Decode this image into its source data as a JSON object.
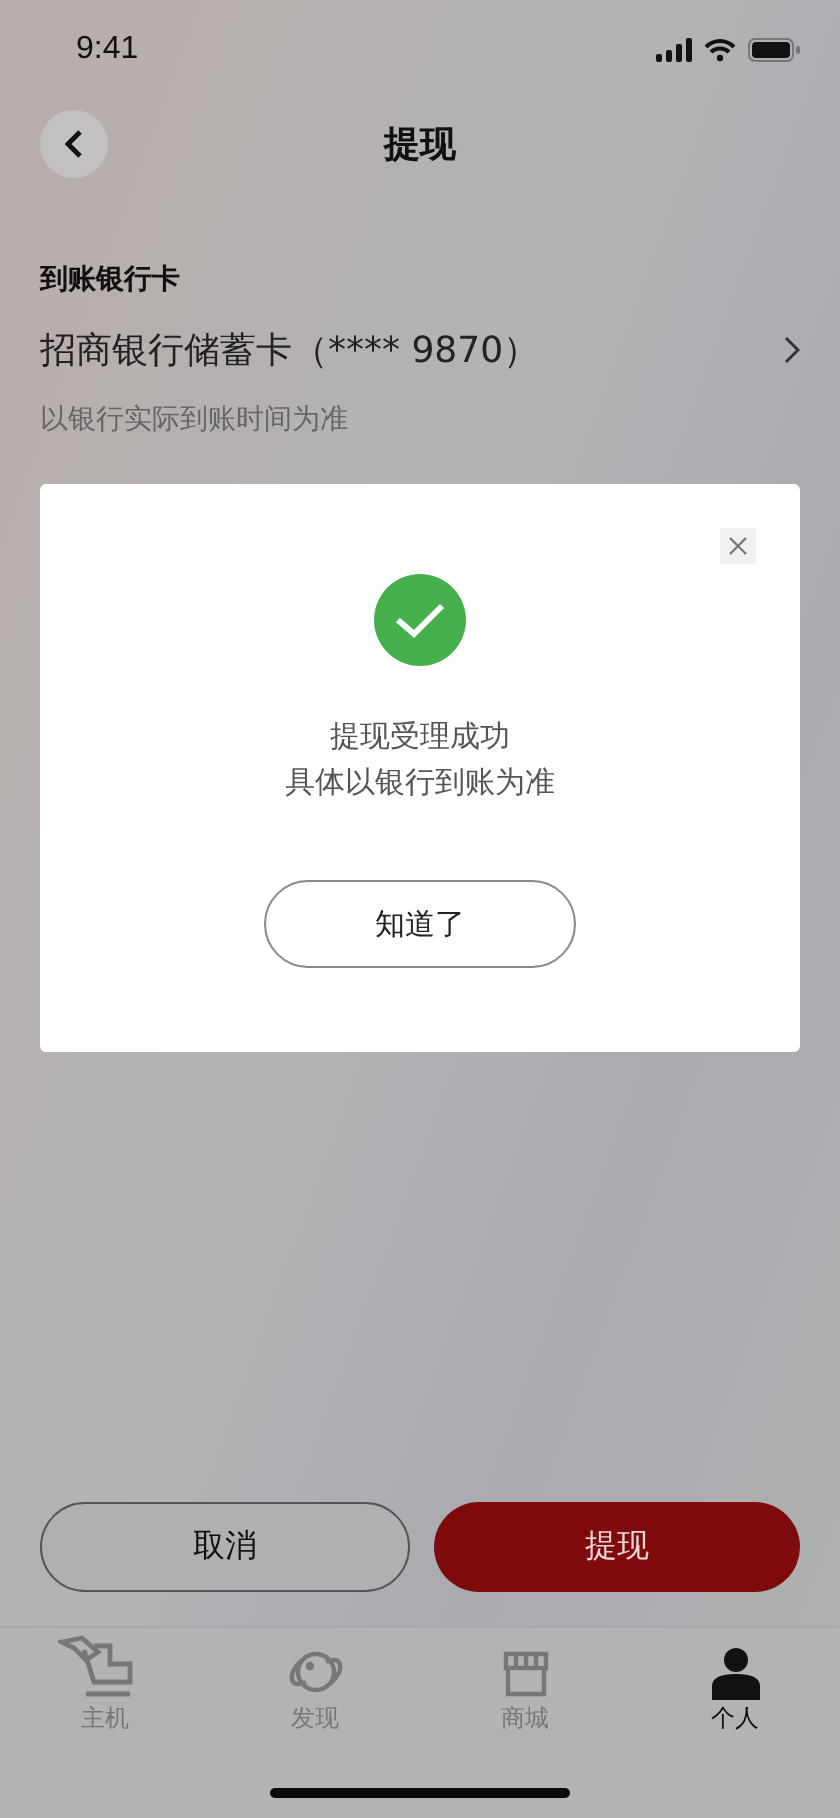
{
  "status_bar": {
    "time": "9:41"
  },
  "nav": {
    "title": "提现"
  },
  "bank_card": {
    "label": "到账银行卡",
    "card": "招商银行储蓄卡（**** 9870）",
    "note": "以银行实际到账时间为准"
  },
  "actions": [
    {
      "label": "取消",
      "kind": "secondary"
    },
    {
      "label": "提现",
      "kind": "primary"
    }
  ],
  "tab_bar": [
    {
      "label": "主机",
      "selected": false
    },
    {
      "label": "发现",
      "selected": false
    },
    {
      "label": "商城",
      "selected": false
    },
    {
      "label": "个人",
      "selected": true
    }
  ],
  "dialog": {
    "lines": [
      "提现受理成功",
      "具体以银行到账为准"
    ],
    "button": "知道了"
  }
}
